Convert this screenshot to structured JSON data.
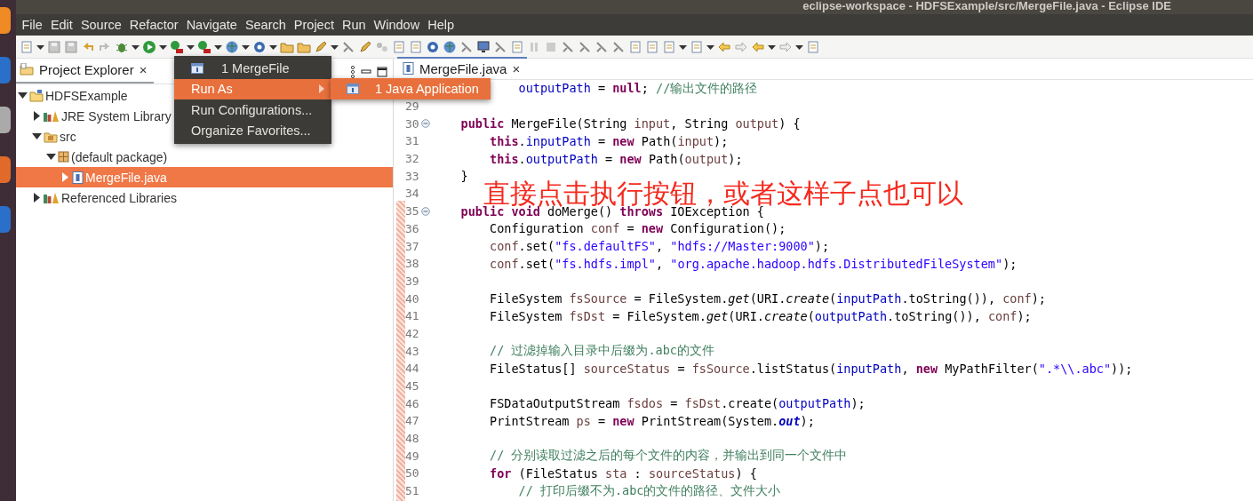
{
  "window": {
    "title": "eclipse-workspace - HDFSExample/src/MergeFile.java - Eclipse IDE"
  },
  "menu_bar": [
    "File",
    "Edit",
    "Source",
    "Refactor",
    "Navigate",
    "Search",
    "Project",
    "Run",
    "Window",
    "Help"
  ],
  "project_explorer": {
    "tab": "Project Explorer",
    "close": "×",
    "tree": [
      {
        "label": "HDFSExample",
        "kind": "project",
        "expanded": true,
        "selected": false,
        "children": [
          {
            "label": "JRE System Library",
            "kind": "library",
            "expanded": false,
            "selected": false
          },
          {
            "label": "src",
            "kind": "source-folder",
            "expanded": true,
            "selected": false,
            "children": [
              {
                "label": "(default package)",
                "kind": "package",
                "expanded": true,
                "selected": false,
                "children": [
                  {
                    "label": "MergeFile.java",
                    "kind": "java-file",
                    "expanded": false,
                    "selected": true
                  }
                ]
              }
            ]
          },
          {
            "label": "Referenced Libraries",
            "kind": "library",
            "expanded": false,
            "selected": false
          }
        ]
      }
    ]
  },
  "run_menu": {
    "items": [
      {
        "label": "1 MergeFile",
        "kind": "launch",
        "selected": false
      },
      {
        "label": "Run As",
        "kind": "submenu",
        "selected": true
      },
      {
        "label": "Run Configurations...",
        "kind": "action",
        "selected": false
      },
      {
        "label": "Organize Favorites...",
        "kind": "action",
        "selected": false
      }
    ],
    "submenu": [
      {
        "label": "1 Java Application",
        "selected": true
      }
    ]
  },
  "editor": {
    "tab": "MergeFile.java",
    "close": "×",
    "lines": [
      {
        "kind": "block",
        "tokens": [
          {
            "kind": "field",
            "text": "outputPath"
          },
          {
            "kind": "plain",
            "text": " = "
          },
          {
            "kind": "kw",
            "text": "null"
          },
          {
            "kind": "plain",
            "text": "; "
          },
          {
            "kind": "comment",
            "text": "//输出文件的路径"
          }
        ]
      },
      {
        "number": "29",
        "fold": false
      },
      {
        "number": "30",
        "fold": true,
        "kind": "class",
        "tokens": [
          {
            "kind": "kw",
            "text": "public"
          },
          {
            "kind": "plain",
            "text": " MergeFile(String "
          },
          {
            "kind": "var",
            "text": "input"
          },
          {
            "kind": "plain",
            "text": ", String "
          },
          {
            "kind": "var",
            "text": "output"
          },
          {
            "kind": "plain",
            "text": ") {"
          }
        ]
      },
      {
        "number": "31",
        "fold": false,
        "kind": "method",
        "tokens": [
          {
            "kind": "kw",
            "text": "this"
          },
          {
            "kind": "plain",
            "text": "."
          },
          {
            "kind": "field",
            "text": "inputPath"
          },
          {
            "kind": "plain",
            "text": " = "
          },
          {
            "kind": "kw",
            "text": "new"
          },
          {
            "kind": "plain",
            "text": " Path("
          },
          {
            "kind": "var",
            "text": "input"
          },
          {
            "kind": "plain",
            "text": ");"
          }
        ]
      },
      {
        "number": "32",
        "fold": false,
        "kind": "method",
        "tokens": [
          {
            "kind": "kw",
            "text": "this"
          },
          {
            "kind": "plain",
            "text": "."
          },
          {
            "kind": "field",
            "text": "outputPath"
          },
          {
            "kind": "plain",
            "text": " = "
          },
          {
            "kind": "kw",
            "text": "new"
          },
          {
            "kind": "plain",
            "text": " Path("
          },
          {
            "kind": "var",
            "text": "output"
          },
          {
            "kind": "plain",
            "text": ");"
          }
        ]
      },
      {
        "number": "33",
        "fold": false,
        "kind": "class",
        "tokens": [
          {
            "kind": "plain",
            "text": "}"
          }
        ]
      },
      {
        "number": "34",
        "fold": false
      },
      {
        "number": "35",
        "fold": true,
        "kind": "class",
        "tokens": [
          {
            "kind": "kw",
            "text": "public void"
          },
          {
            "kind": "plain",
            "text": " doMerge() "
          },
          {
            "kind": "kw",
            "text": "throws"
          },
          {
            "kind": "plain",
            "text": " IOException {"
          }
        ]
      },
      {
        "number": "36",
        "fold": false,
        "kind": "method",
        "tokens": [
          {
            "kind": "plain",
            "text": "Configuration "
          },
          {
            "kind": "var",
            "text": "conf"
          },
          {
            "kind": "plain",
            "text": " = "
          },
          {
            "kind": "kw",
            "text": "new"
          },
          {
            "kind": "plain",
            "text": " Configuration();"
          }
        ]
      },
      {
        "number": "37",
        "fold": false,
        "kind": "method",
        "tokens": [
          {
            "kind": "var",
            "text": "conf"
          },
          {
            "kind": "plain",
            "text": ".set("
          },
          {
            "kind": "str",
            "text": "\"fs.defaultFS\""
          },
          {
            "kind": "plain",
            "text": ", "
          },
          {
            "kind": "str",
            "text": "\"hdfs://Master:9000\""
          },
          {
            "kind": "plain",
            "text": ");"
          }
        ]
      },
      {
        "number": "38",
        "fold": false,
        "kind": "method",
        "tokens": [
          {
            "kind": "var",
            "text": "conf"
          },
          {
            "kind": "plain",
            "text": ".set("
          },
          {
            "kind": "str",
            "text": "\"fs.hdfs.impl\""
          },
          {
            "kind": "plain",
            "text": ", "
          },
          {
            "kind": "str",
            "text": "\"org.apache.hadoop.hdfs.DistributedFileSystem\""
          },
          {
            "kind": "plain",
            "text": ");"
          }
        ]
      },
      {
        "number": "39",
        "fold": false
      },
      {
        "number": "40",
        "fold": false,
        "kind": "method",
        "tokens": [
          {
            "kind": "plain",
            "text": "FileSystem "
          },
          {
            "kind": "var",
            "text": "fsSource"
          },
          {
            "kind": "plain",
            "text": " = FileSystem."
          },
          {
            "kind": "static",
            "text": "get"
          },
          {
            "kind": "plain",
            "text": "(URI."
          },
          {
            "kind": "static",
            "text": "create"
          },
          {
            "kind": "plain",
            "text": "("
          },
          {
            "kind": "field",
            "text": "inputPath"
          },
          {
            "kind": "plain",
            "text": ".toString()), "
          },
          {
            "kind": "var",
            "text": "conf"
          },
          {
            "kind": "plain",
            "text": ");"
          }
        ]
      },
      {
        "number": "41",
        "fold": false,
        "kind": "method",
        "tokens": [
          {
            "kind": "plain",
            "text": "FileSystem "
          },
          {
            "kind": "var",
            "text": "fsDst"
          },
          {
            "kind": "plain",
            "text": " = FileSystem."
          },
          {
            "kind": "static",
            "text": "get"
          },
          {
            "kind": "plain",
            "text": "(URI."
          },
          {
            "kind": "static",
            "text": "create"
          },
          {
            "kind": "plain",
            "text": "("
          },
          {
            "kind": "field",
            "text": "outputPath"
          },
          {
            "kind": "plain",
            "text": ".toString()), "
          },
          {
            "kind": "var",
            "text": "conf"
          },
          {
            "kind": "plain",
            "text": ");"
          }
        ]
      },
      {
        "number": "42",
        "fold": false
      },
      {
        "number": "43",
        "fold": false,
        "kind": "method",
        "tokens": [
          {
            "kind": "comment",
            "text": "// 过滤掉输入目录中后缀为.abc的文件"
          }
        ]
      },
      {
        "number": "44",
        "fold": false,
        "kind": "method",
        "tokens": [
          {
            "kind": "plain",
            "text": "FileStatus[] "
          },
          {
            "kind": "var",
            "text": "sourceStatus"
          },
          {
            "kind": "plain",
            "text": " = "
          },
          {
            "kind": "var",
            "text": "fsSource"
          },
          {
            "kind": "plain",
            "text": ".listStatus("
          },
          {
            "kind": "field",
            "text": "inputPath"
          },
          {
            "kind": "plain",
            "text": ", "
          },
          {
            "kind": "kw",
            "text": "new"
          },
          {
            "kind": "plain",
            "text": " MyPathFilter("
          },
          {
            "kind": "str",
            "text": "\".*\\\\.abc\""
          },
          {
            "kind": "plain",
            "text": "));"
          }
        ]
      },
      {
        "number": "45",
        "fold": false
      },
      {
        "number": "46",
        "fold": false,
        "kind": "method",
        "tokens": [
          {
            "kind": "plain",
            "text": "FSDataOutputStream "
          },
          {
            "kind": "var",
            "text": "fsdos"
          },
          {
            "kind": "plain",
            "text": " = "
          },
          {
            "kind": "var",
            "text": "fsDst"
          },
          {
            "kind": "plain",
            "text": ".create("
          },
          {
            "kind": "field",
            "text": "outputPath"
          },
          {
            "kind": "plain",
            "text": ");"
          }
        ]
      },
      {
        "number": "47",
        "fold": false,
        "kind": "method",
        "tokens": [
          {
            "kind": "plain",
            "text": "PrintStream "
          },
          {
            "kind": "var",
            "text": "ps"
          },
          {
            "kind": "plain",
            "text": " = "
          },
          {
            "kind": "kw",
            "text": "new"
          },
          {
            "kind": "plain",
            "text": " PrintStream(System."
          },
          {
            "kind": "static_field",
            "text": "out"
          },
          {
            "kind": "plain",
            "text": ");"
          }
        ]
      },
      {
        "number": "48",
        "fold": false
      },
      {
        "number": "49",
        "fold": false,
        "kind": "method",
        "tokens": [
          {
            "kind": "comment",
            "text": "// 分别读取过滤之后的每个文件的内容，并输出到同一个文件中"
          }
        ]
      },
      {
        "number": "50",
        "fold": false,
        "kind": "method",
        "tokens": [
          {
            "kind": "kw",
            "text": "for"
          },
          {
            "kind": "plain",
            "text": " (FileStatus "
          },
          {
            "kind": "var",
            "text": "sta"
          },
          {
            "kind": "plain",
            "text": " : "
          },
          {
            "kind": "var",
            "text": "sourceStatus"
          },
          {
            "kind": "plain",
            "text": ") {"
          }
        ]
      },
      {
        "number": "51",
        "fold": false,
        "kind": "block",
        "tokens": [
          {
            "kind": "comment",
            "text": "// 打印后缀不为.abc的文件的路径、文件大小"
          }
        ]
      }
    ]
  },
  "annotation": "直接点击执行按钮，或者这样子点也可以"
}
